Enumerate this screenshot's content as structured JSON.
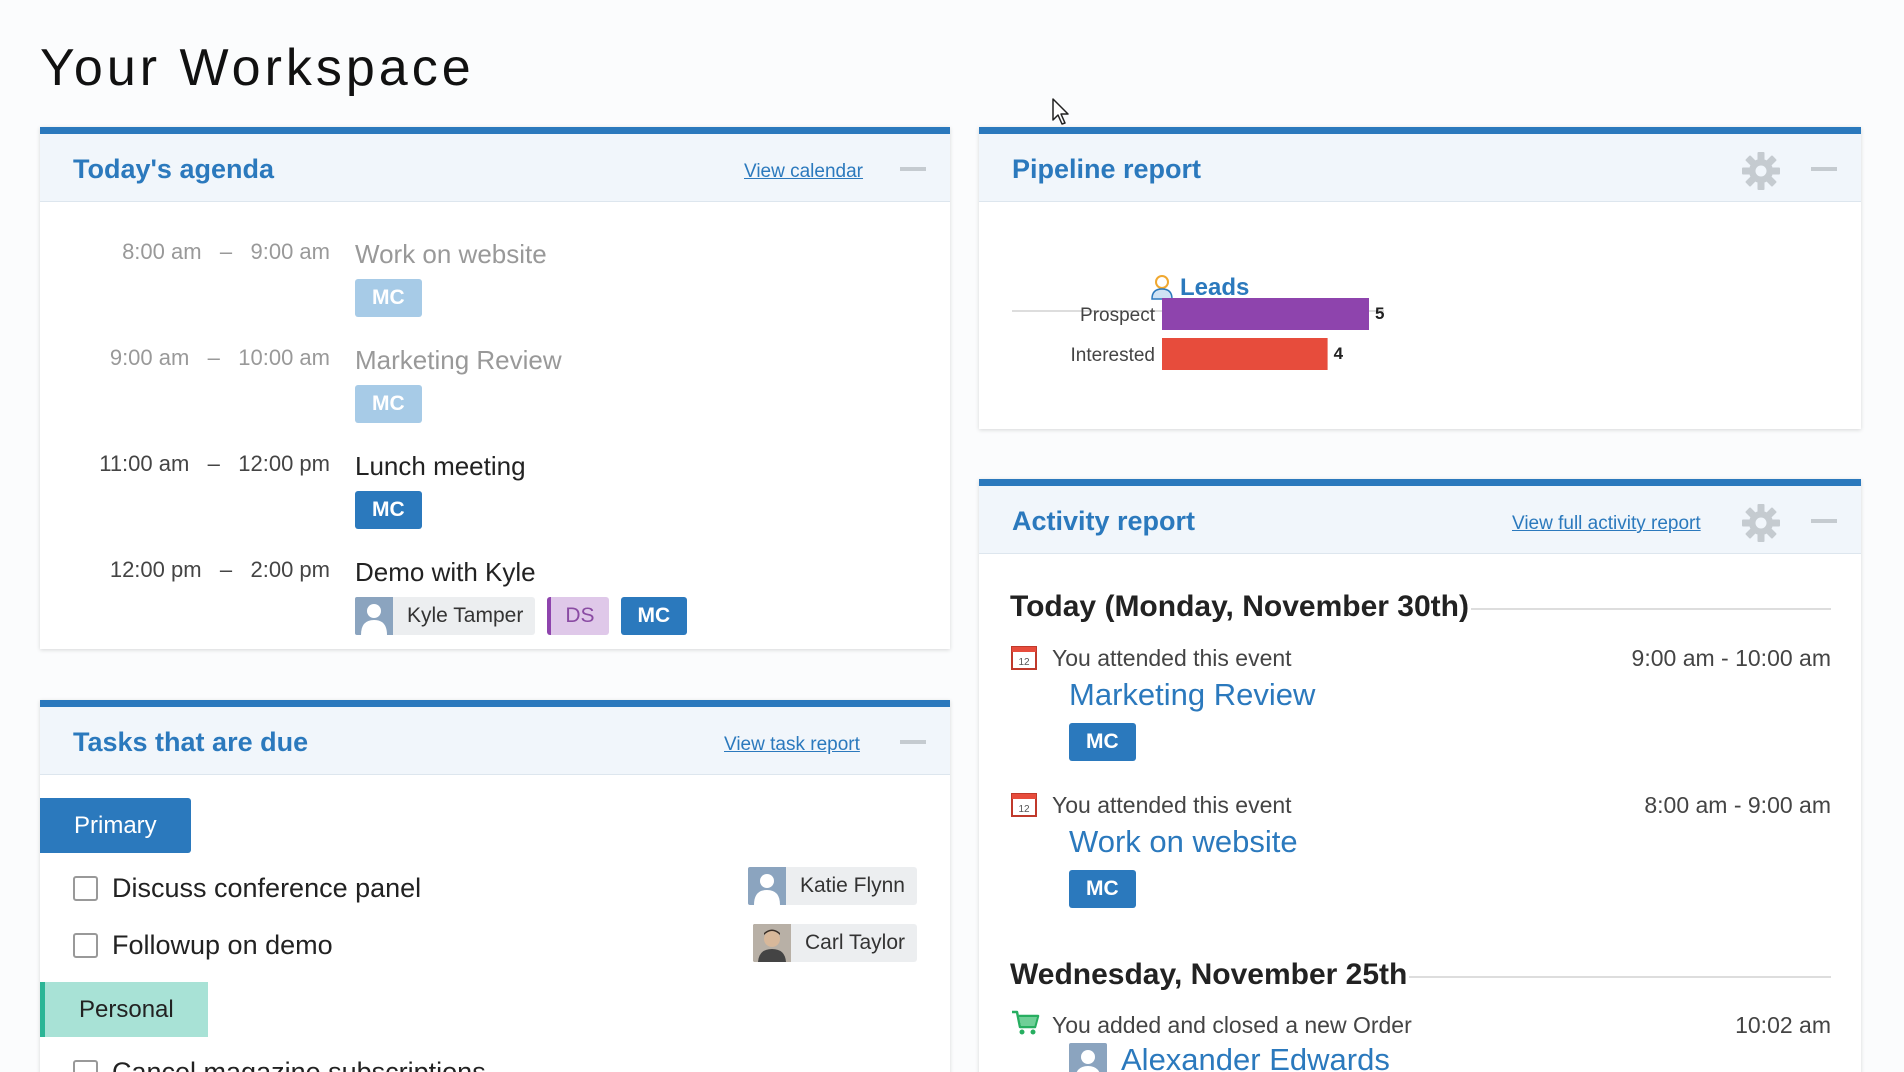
{
  "page": {
    "title": "Your Workspace"
  },
  "agenda": {
    "title": "Today's agenda",
    "link": "View calendar",
    "items": [
      {
        "start": "8:00 am",
        "sep": "–",
        "end": "9:00 am",
        "title": "Work on website",
        "tags": [
          "MC"
        ],
        "past": true
      },
      {
        "start": "9:00 am",
        "sep": "–",
        "end": "10:00 am",
        "title": "Marketing Review",
        "tags": [
          "MC"
        ],
        "past": true
      },
      {
        "start": "11:00 am",
        "sep": "–",
        "end": "12:00 pm",
        "title": "Lunch meeting",
        "tags": [
          "MC"
        ],
        "past": false
      },
      {
        "start": "12:00 pm",
        "sep": "–",
        "end": "2:00 pm",
        "title": "Demo with Kyle",
        "person": "Kyle Tamper",
        "tags": [
          "DS",
          "MC"
        ],
        "past": false
      }
    ]
  },
  "tasks": {
    "title": "Tasks that are due",
    "link": "View task report",
    "groups": [
      {
        "label": "Primary",
        "items": [
          {
            "label": "Discuss conference panel",
            "assignee": "Katie Flynn"
          },
          {
            "label": "Followup on demo",
            "assignee": "Carl Taylor"
          }
        ]
      },
      {
        "label": "Personal",
        "items": [
          {
            "label": "Cancel magazine subscriptions"
          }
        ]
      }
    ]
  },
  "pipeline": {
    "title": "Pipeline report",
    "leads_label": "Leads"
  },
  "chart_data": {
    "type": "bar",
    "orientation": "horizontal",
    "title": "Leads",
    "categories": [
      "Prospect",
      "Interested"
    ],
    "values": [
      5,
      4
    ],
    "colors": [
      "#8e44ad",
      "#e74c3c"
    ],
    "xlim": [
      0,
      5
    ]
  },
  "activity": {
    "title": "Activity report",
    "link": "View full activity report",
    "days": [
      {
        "heading": "Today (Monday, November 30th)",
        "entries": [
          {
            "icon": "calendar-icon",
            "desc": "You attended this event",
            "time": "9:00 am - 10:00 am",
            "title": "Marketing Review",
            "tag": "MC",
            "cal_day": "12"
          },
          {
            "icon": "calendar-icon",
            "desc": "You attended this event",
            "time": "8:00 am - 9:00 am",
            "title": "Work on website",
            "tag": "MC",
            "cal_day": "12"
          }
        ]
      },
      {
        "heading": "Wednesday, November 25th",
        "entries": [
          {
            "icon": "cart-icon",
            "desc": "You added and closed a new Order",
            "time": "10:02 am",
            "title": "Alexander Edwards"
          }
        ]
      }
    ]
  },
  "colors": {
    "accent": "#2b79bd",
    "past_tag": "#a7cbe7",
    "ds_tag": "#8e44ad",
    "personal": "#2bb596"
  }
}
